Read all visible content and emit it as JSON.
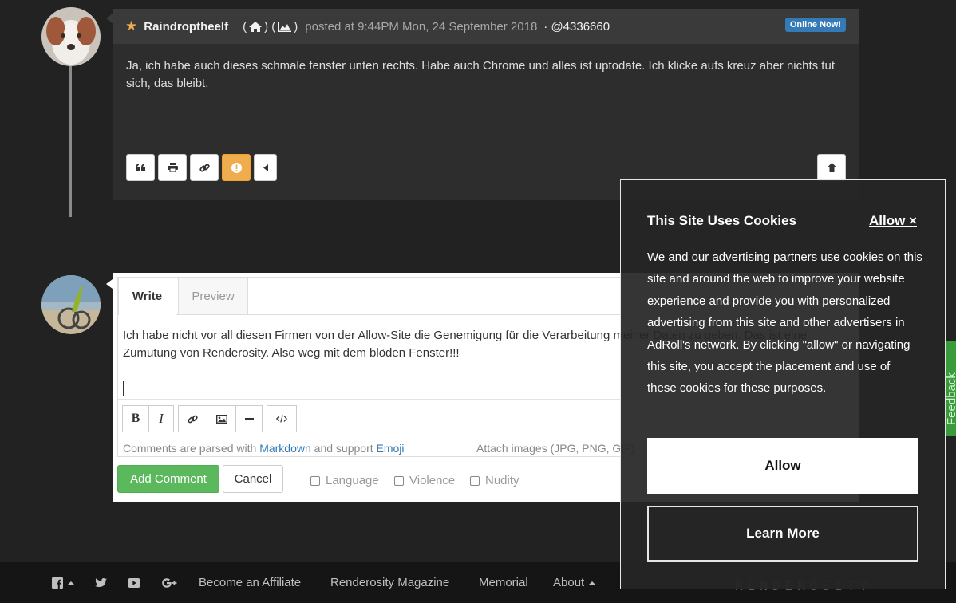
{
  "post": {
    "username": "Raindroptheelf",
    "paren_open": "(",
    "paren_mid": ") (",
    "paren_close": ")",
    "posted": "posted at 9:44PM Mon, 24 September 2018",
    "post_id": "· @4336660",
    "online_badge": "Online Now!",
    "body": "Ja, ich habe auch dieses schmale fenster unten rechts. Habe auch Chrome und alles ist uptodate. Ich klicke aufs kreuz aber nichts tut sich, das bleibt."
  },
  "editor": {
    "tab_write": "Write",
    "tab_preview": "Preview",
    "text": "Ich habe nicht vor all diesen Firmen von der Allow-Site die Genemigung für die Verarbeitung meiner Daten zu geben. Das ist eine Zumutung von Renderosity. Also weg mit dem blöden Fenster!!!",
    "bold_label": "B",
    "italic_label": "I",
    "hint_prefix": "Comments are parsed with",
    "hint_markdown": "Markdown",
    "hint_mid": "and support",
    "hint_emoji": "Emoji",
    "attach_text": "Attach images (JPG, PNG, GIF)",
    "add_button": "Add Comment",
    "cancel_button": "Cancel",
    "checkboxes": [
      "Language",
      "Violence",
      "Nudity"
    ]
  },
  "feedback_tab": "Feedback",
  "footer": {
    "links": [
      "Become an Affiliate",
      "Renderosity Magazine",
      "Memorial",
      "About"
    ],
    "logo": "RENDEROSITY"
  },
  "cookie": {
    "title": "This Site Uses Cookies",
    "close": "Allow ×",
    "text": "We and our advertising partners use cookies on this site and around the web to improve your website experience and provide you with personalized advertising from this site and other advertisers in AdRoll's network. By clicking \"allow\" or navigating this site, you accept the placement and use of these cookies for these purposes.",
    "allow_button": "Allow",
    "learn_more_button": "Learn More"
  },
  "colors": {
    "background": "#222222",
    "post_header": "#3a3a3a",
    "online_badge": "#337ab7",
    "warn_button": "#f0ad4e",
    "add_button": "#5cb85c",
    "link": "#337ab7",
    "feedback_tab": "#3a9b3a"
  },
  "icons": [
    "star-icon",
    "home-icon",
    "gallery-icon",
    "quote-icon",
    "print-icon",
    "link-icon",
    "alert-icon",
    "caret-left-icon",
    "arrow-up-icon",
    "image-icon",
    "hr-icon",
    "code-icon",
    "facebook-icon",
    "twitter-icon",
    "youtube-icon",
    "google-plus-icon"
  ]
}
